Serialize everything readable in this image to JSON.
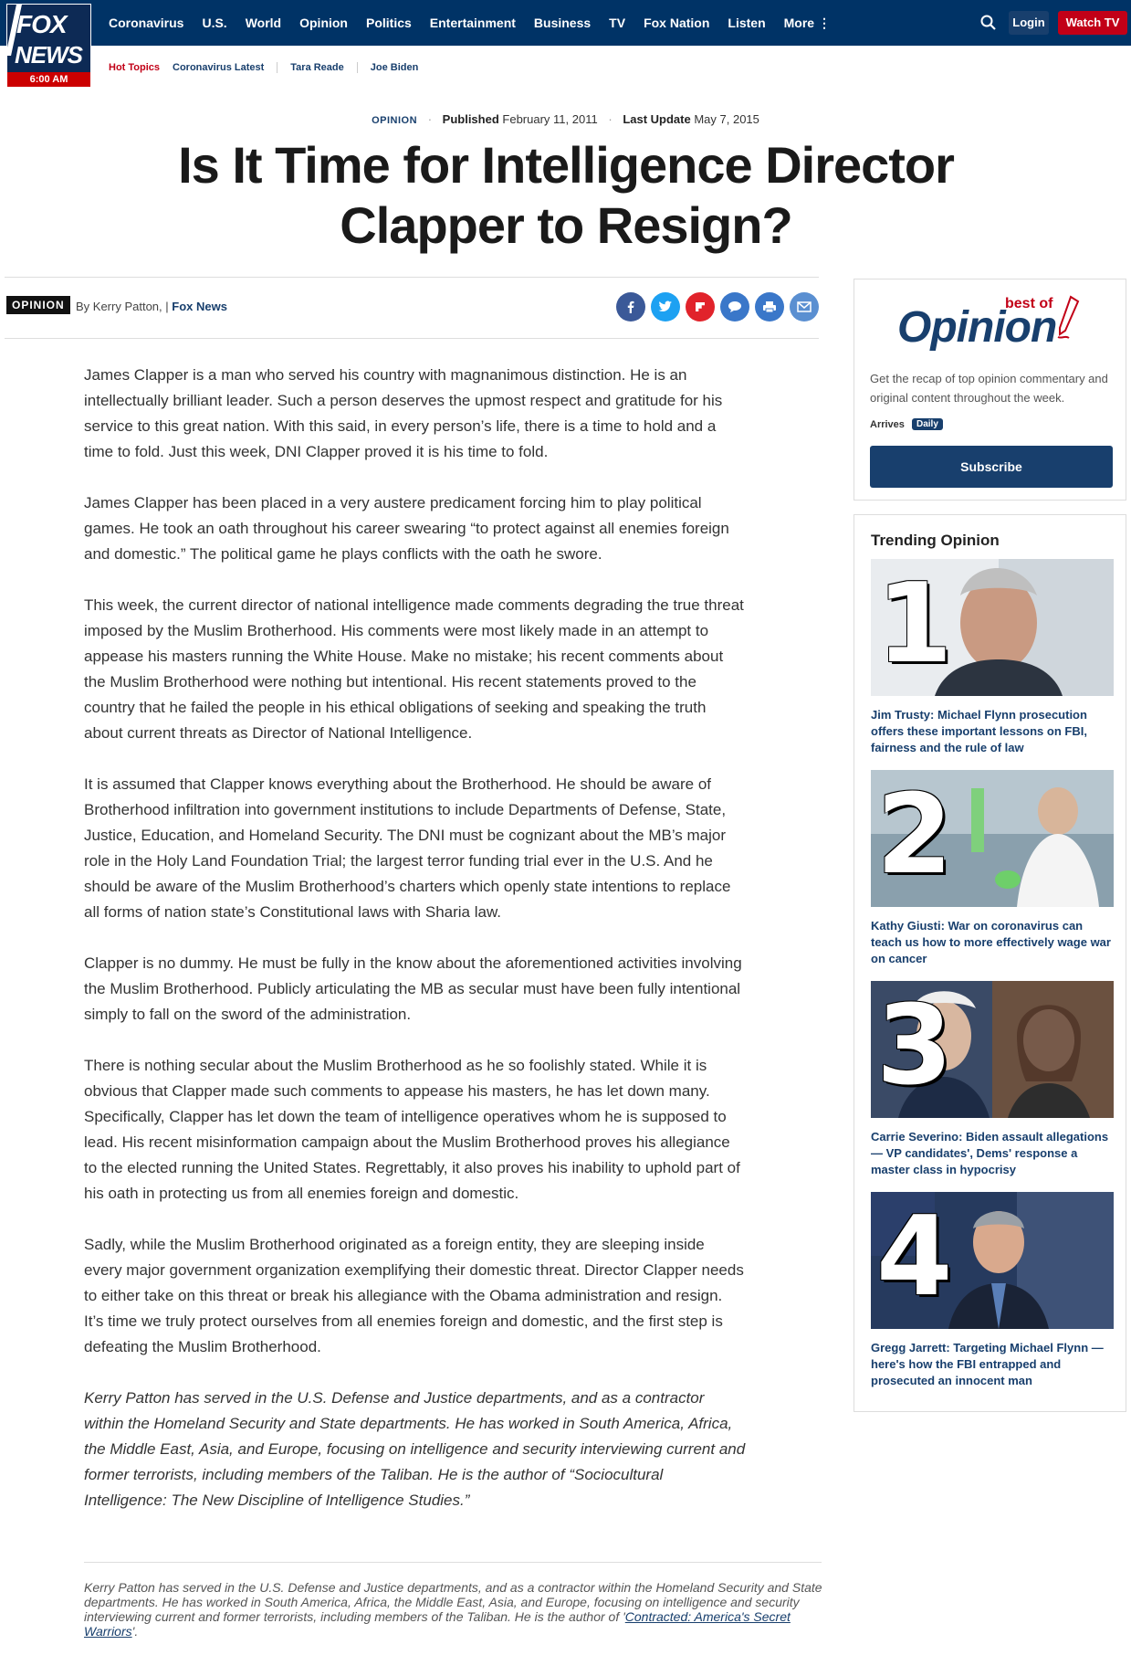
{
  "header": {
    "logo_line1": "FOX",
    "logo_line2": "NEWS",
    "logo_time": "6:00 AM",
    "nav": [
      "Coronavirus",
      "U.S.",
      "World",
      "Opinion",
      "Politics",
      "Entertainment",
      "Business",
      "TV",
      "Fox Nation",
      "Listen",
      "More ⋮"
    ],
    "login": "Login",
    "watch_tv": "Watch TV",
    "subnav_hot": "Hot Topics",
    "subnav": [
      "Coronavirus Latest",
      "Tara Reade",
      "Joe Biden"
    ]
  },
  "article": {
    "eyebrow": "OPINION",
    "published_label": "Published",
    "published": "February 11, 2011",
    "updated_label": "Last Update",
    "updated": "May 7, 2015",
    "headline": "Is It Time for Intelligence Director Clapper to Resign?",
    "badge": "OPINION",
    "byline": "By Kerry Patton, |",
    "source": "Fox News",
    "paragraphs": [
      "James Clapper is a man who served his country with magnanimous distinction. He is an intellectually brilliant leader. Such a person deserves the upmost respect and gratitude for his service to this great nation. With this said, in every person’s life, there is a time to hold and a time to fold. Just this week, DNI Clapper proved it is his time to fold.",
      "James Clapper has been placed in a very austere predicament forcing him to play political games. He took an oath throughout his career swearing “to protect against all enemies foreign and domestic.” The political game he plays conflicts with the oath he swore.",
      "This week, the current director of national intelligence made comments degrading the true threat imposed by the Muslim Brotherhood. His comments were most likely made in an attempt to appease his masters running the White House. Make no mistake; his recent comments about the Muslim Brotherhood were nothing but intentional. His recent statements proved to the country that he failed the people in his ethical obligations of seeking and speaking the truth about current threats as Director of National Intelligence.",
      "It is assumed that Clapper knows everything about the Brotherhood. He should be aware of Brotherhood infiltration into government institutions to include Departments of Defense, State, Justice, Education, and Homeland Security. The DNI must be cognizant about the MB’s major role in the Holy Land Foundation Trial; the largest terror funding trial ever in the U.S. And he should be aware of the Muslim Brotherhood’s charters which openly state intentions to replace all forms of nation state’s Constitutional laws with Sharia law.",
      "Clapper is no dummy. He must be fully in the know about the aforementioned activities involving the Muslim Brotherhood. Publicly articulating the MB as secular must have been fully intentional simply to fall on the sword of the administration.",
      "There is nothing secular about the Muslim Brotherhood as he so foolishly stated. While it is obvious that Clapper made such comments to appease his masters, he has let down many. Specifically, Clapper has let down the team of intelligence operatives whom he is supposed to lead. His recent misinformation campaign about the Muslim Brotherhood proves his allegiance to the elected running the United States. Regrettably, it also proves his inability to uphold part of his oath in protecting us from all enemies foreign and domestic.",
      "Sadly, while the Muslim Brotherhood originated as a foreign entity, they are sleeping inside every major government organization exemplifying their domestic threat. Director Clapper needs to either take on this threat or break his allegiance with the Obama administration and resign. It’s time we truly protect ourselves from all enemies foreign and domestic, and the first step is defeating the Muslim Brotherhood."
    ],
    "bio": "Kerry Patton has served in the U.S. Defense and Justice departments, and as a contractor within the Homeland Security and State departments. He has worked in South America, Africa, the Middle East, Asia, and Europe, focusing on intelligence and security interviewing current and former terrorists, including members of the Taliban. He is the author of “Sociocultural Intelligence: The New Discipline of Intelligence Studies.”",
    "endnote": "Kerry Patton has served in the U.S. Defense and Justice departments, and as a contractor within the Homeland Security and State departments. He has worked in South America, Africa, the Middle East, Asia, and Europe, focusing on intelligence and security interviewing current and former terrorists, including members of the Taliban. He is the author of  '",
    "endnote_link": "Contracted: America's Secret Warriors",
    "endnote_tail": "'."
  },
  "sidebar": {
    "promo_best": "best of",
    "promo_title": "Opinion",
    "promo_desc": "Get the recap of top opinion commentary and original content throughout the week.",
    "arrives": "Arrives",
    "daily": "Daily",
    "subscribe": "Subscribe",
    "trending_title": "Trending Opinion",
    "trending": [
      {
        "num": "1",
        "caption": "Jim Trusty: Michael Flynn prosecution offers these important lessons on FBI, fairness and the rule of law"
      },
      {
        "num": "2",
        "caption": "Kathy Giusti: War on coronavirus can teach us how to more effectively wage war on cancer"
      },
      {
        "num": "3",
        "caption": "Carrie Severino: Biden assault allegations — VP candidates', Dems' response a master class in hypocrisy"
      },
      {
        "num": "4",
        "caption": "Gregg Jarrett: Targeting Michael Flynn — here's how the FBI entrapped and prosecuted an innocent man"
      }
    ]
  },
  "colors": {
    "navy": "#003366",
    "brand_blue": "#183f6d",
    "red": "#c20017"
  }
}
